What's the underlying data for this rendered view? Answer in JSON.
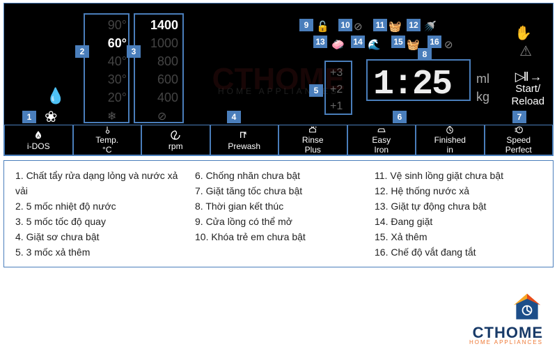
{
  "temps": {
    "values": [
      "90°",
      "60°",
      "40°",
      "30°",
      "20°"
    ],
    "selected_index": 1,
    "cold_icon": "❄"
  },
  "rpms": {
    "values": [
      "1400",
      "1000",
      "800",
      "600",
      "400"
    ],
    "selected_index": 0,
    "nospin_icon": "⊘"
  },
  "extra_rinse": {
    "values": [
      "+3",
      "+2",
      "+1"
    ]
  },
  "time_display": "1:25",
  "units": {
    "volume": "ml",
    "weight": "kg"
  },
  "start": {
    "symbol": "▷II →",
    "line1": "Start/",
    "line2": "Reload"
  },
  "top_icons": [
    "🔓",
    "⊘",
    "🧺",
    "🚿",
    "🧼",
    "🌊",
    "🧺",
    "⊘"
  ],
  "right_icons": [
    "✋",
    "⚠"
  ],
  "left_icons": [
    "💧",
    "❀"
  ],
  "bottom_options": [
    {
      "icon": "droplet",
      "label": "i-DOS"
    },
    {
      "icon": "thermo",
      "label": "Temp. °C"
    },
    {
      "icon": "spin",
      "label": "rpm"
    },
    {
      "icon": "prewash",
      "label": "Prewash"
    },
    {
      "icon": "rinse",
      "label": "Rinse Plus"
    },
    {
      "icon": "iron",
      "label": "Easy Iron"
    },
    {
      "icon": "clock",
      "label": "Finished in"
    },
    {
      "icon": "speed",
      "label": "Speed Perfect"
    }
  ],
  "legend": {
    "col1": [
      "1. Chất tẩy rửa dạng lỏng và nước xả vải",
      "2. 5 mốc nhiệt độ nước",
      "3. 5 mốc tốc độ quay",
      "4. Giặt sơ chưa bật",
      "5. 3 mốc xả thêm"
    ],
    "col2": [
      "6. Chống nhăn chưa bật",
      "7. Giặt tăng tốc chưa bật",
      "8. Thời gian kết thúc",
      "9. Cửa lồng có thể mở",
      "10. Khóa trẻ em chưa bật"
    ],
    "col3": [
      "11. Vệ sinh lồng giặt chưa bật",
      "12. Hệ thống nước xả",
      "13. Giặt tự động chưa bật",
      "14. Đang giặt",
      "15. Xả thêm",
      "16. Chế độ vắt đang tắt"
    ]
  },
  "brand": {
    "name": "CTHOME",
    "tag": "HOME APPLIANCES"
  },
  "watermark": "CTHOME"
}
